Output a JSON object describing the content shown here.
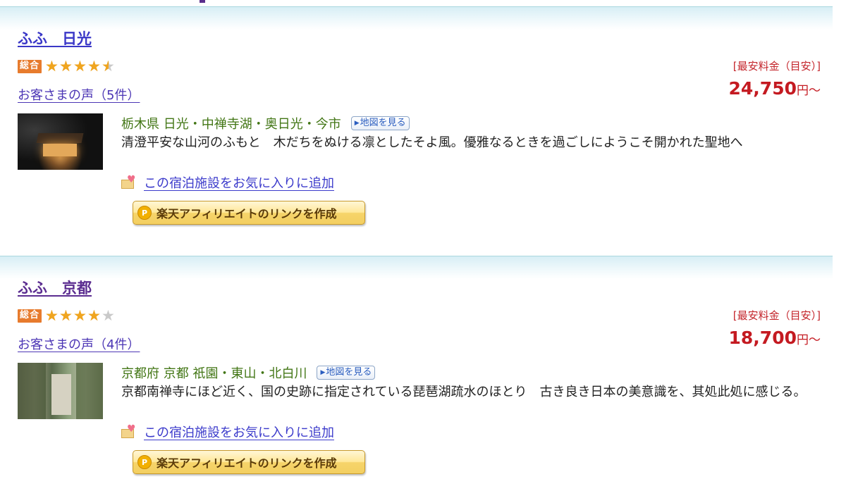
{
  "hotels": [
    {
      "name": "ふふ　日光",
      "rating_badge": "総合",
      "rating_value": 4.5,
      "reviews": "お客さまの声（5件）",
      "price_label": "[最安料金（目安）]",
      "price_value": "24,750",
      "price_unit": "円〜",
      "location": "栃木県 日光・中禅寺湖・奥日光・今市",
      "map_button": "地図を見る",
      "description": "清澄平安な山河のふもと　木だちをぬける凛としたそよ風。優雅なるときを過ごしにようこそ開かれた聖地へ",
      "favorite": "この宿泊施設をお気に入りに追加",
      "affiliate_button": "楽天アフィリエイトのリンクを作成",
      "coin_letter": "P"
    },
    {
      "name": "ふふ　京都",
      "rating_badge": "総合",
      "rating_value": 4.0,
      "reviews": "お客さまの声（4件）",
      "price_label": "[最安料金（目安）]",
      "price_value": "18,700",
      "price_unit": "円〜",
      "location": "京都府 京都 祇園・東山・北白川",
      "map_button": "地図を見る",
      "description": "京都南禅寺にほど近く、国の史跡に指定されている琵琶湖疏水のほとり　古き良き日本の美意識を、其処此処に感じる。",
      "favorite": "この宿泊施設をお気に入りに追加",
      "affiliate_button": "楽天アフィリエイトのリンクを作成",
      "coin_letter": "P"
    }
  ],
  "colors": {
    "price": "#c41a21",
    "location": "#427615",
    "link": "#3b3acb",
    "name_visited": "#5b2d90"
  }
}
